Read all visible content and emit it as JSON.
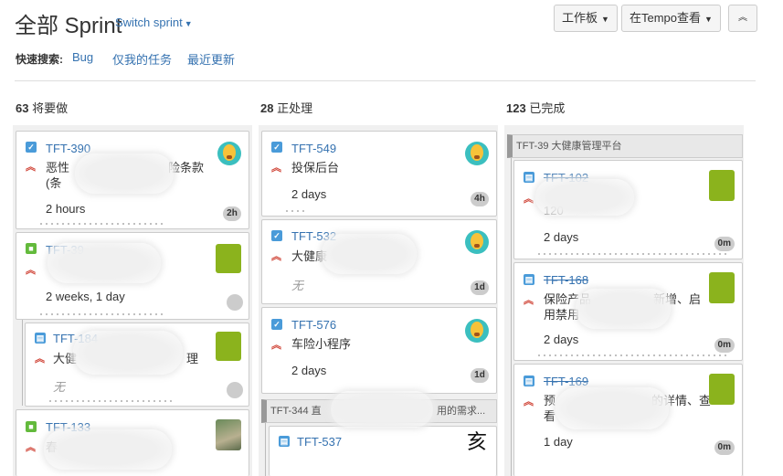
{
  "header": {
    "title": "全部 Sprint",
    "switch_sprint": "Switch sprint",
    "board_button": "工作板",
    "tempo_button": "在Tempo查看",
    "collapse_icon": "chevron-double-up-icon"
  },
  "quick_search": {
    "label": "快速搜索:",
    "filters": [
      "Bug",
      "仅我的任务",
      "最近更新"
    ]
  },
  "columns": [
    {
      "count": "63",
      "name": "将要做"
    },
    {
      "count": "28",
      "name": "正处理"
    },
    {
      "count": "123",
      "name": "已完成"
    }
  ],
  "todo": [
    {
      "key": "TFT-390",
      "summary_a": "恶性",
      "summary_b": "险条款",
      "summary_c": "(条",
      "estimate": "2 hours",
      "badge": "2h"
    },
    {
      "key": "TFT-39",
      "estimate": "2 weeks, 1 day"
    },
    {
      "key": "TFT-184",
      "summary_a": "大健",
      "summary_b": "理",
      "estimate": "无"
    },
    {
      "key": "TFT-133",
      "summary_a": "春"
    }
  ],
  "in_progress": [
    {
      "key": "TFT-549",
      "summary": "投保后台",
      "estimate": "2 days",
      "badge": "4h"
    },
    {
      "key": "TFT-532",
      "summary": "大健康",
      "estimate": "无",
      "badge": "1d"
    },
    {
      "key": "TFT-576",
      "summary": "车险小程序",
      "estimate": "2 days",
      "badge": "1d"
    },
    {
      "epic_a": "TFT-344 直",
      "epic_b": "用的需求...",
      "key": "TFT-537"
    }
  ],
  "done": {
    "epic": "TFT-39  大健康管理平台",
    "cards": [
      {
        "key": "TFT-102",
        "summary_a": "",
        "summary_b": "120",
        "estimate": "2 days",
        "badge": "0m"
      },
      {
        "key": "TFT-168",
        "summary_a": "保险产品",
        "summary_b": "新增、启",
        "summary_c": "用禁用",
        "estimate": "2 days",
        "badge": "0m"
      },
      {
        "key": "TFT-169",
        "summary_a": "预",
        "summary_b": "的详情、查",
        "summary_c": "看",
        "estimate": "1 day",
        "badge": "0m"
      }
    ]
  },
  "colors": {
    "link": "#3572b0",
    "priority": "#d04437",
    "task_icon": "#4a9bd9",
    "story_icon": "#63ba3c",
    "avatar_green": "#8bb31d"
  }
}
